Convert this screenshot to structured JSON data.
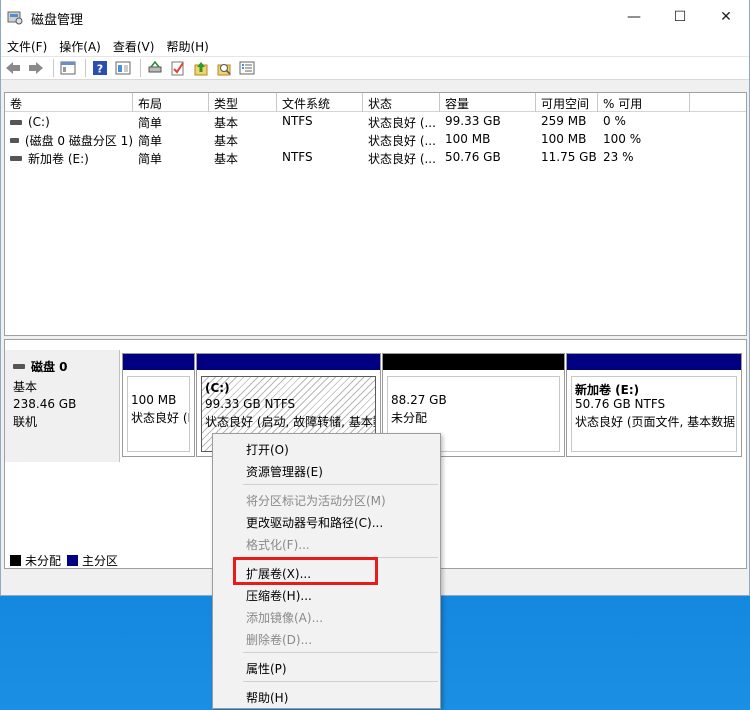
{
  "window": {
    "title": "磁盘管理",
    "minimize": "—",
    "maximize": "☐",
    "close": "✕"
  },
  "menu": [
    "文件(F)",
    "操作(A)",
    "查看(V)",
    "帮助(H)"
  ],
  "toolbar": [
    "back-icon",
    "forward-icon",
    "console-icon",
    "help-icon",
    "view-icon",
    "connect-icon",
    "check-icon",
    "up-icon",
    "search-icon",
    "properties-icon"
  ],
  "volumes": {
    "headers": [
      "卷",
      "布局",
      "类型",
      "文件系统",
      "状态",
      "容量",
      "可用空间",
      "% 可用"
    ],
    "rows": [
      [
        "(C:)",
        "简单",
        "基本",
        "NTFS",
        "状态良好 (...",
        "99.33 GB",
        "259 MB",
        "0 %"
      ],
      [
        "(磁盘 0 磁盘分区 1)",
        "简单",
        "基本",
        "",
        "状态良好 (...",
        "100 MB",
        "100 MB",
        "100 %"
      ],
      [
        "新加卷 (E:)",
        "简单",
        "基本",
        "NTFS",
        "状态良好 (...",
        "50.76 GB",
        "11.75 GB",
        "23 %"
      ]
    ]
  },
  "disk": {
    "name": "磁盘 0",
    "type": "基本",
    "size": "238.46 GB",
    "status": "联机"
  },
  "partitions": [
    {
      "title": "",
      "line1": "100 MB",
      "line2": "状态良好 (E",
      "bar": "#000080"
    },
    {
      "title": "(C:)",
      "line1": "99.33 GB NTFS",
      "line2": "状态良好 (启动, 故障转储, 基本数",
      "bar": "#000080"
    },
    {
      "title": "",
      "line1": "88.27 GB",
      "line2": "未分配",
      "bar": "#000000"
    },
    {
      "title": "新加卷  (E:)",
      "line1": "50.76 GB NTFS",
      "line2": "状态良好 (页面文件, 基本数据",
      "bar": "#000080"
    }
  ],
  "legend": {
    "unallocated": "未分配",
    "primary": "主分区",
    "unallocated_color": "#000000",
    "primary_color": "#000080"
  },
  "context_menu": {
    "open": "打开(O)",
    "explorer": "资源管理器(E)",
    "mark_active": "将分区标记为活动分区(M)",
    "change_letter": "更改驱动器号和路径(C)...",
    "format": "格式化(F)...",
    "extend": "扩展卷(X)...",
    "shrink": "压缩卷(H)...",
    "add_mirror": "添加镜像(A)...",
    "delete": "删除卷(D)...",
    "properties": "属性(P)",
    "help": "帮助(H)"
  },
  "accent": "#e81b1b"
}
